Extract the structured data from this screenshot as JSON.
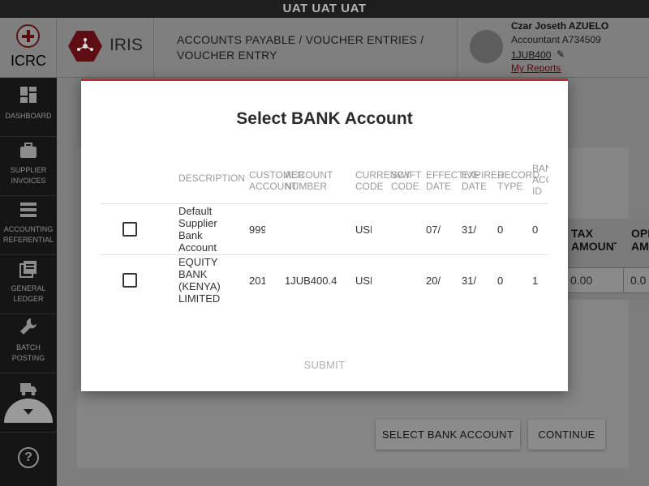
{
  "env_banner": "UAT UAT UAT",
  "header": {
    "org_name": "ICRC",
    "app_name": "IRIS",
    "breadcrumb": "ACCOUNTS PAYABLE / VOUCHER ENTRIES /\nVOUCHER ENTRY",
    "user": {
      "name": "Czar Joseth AZUELO",
      "role": "Accountant A734509",
      "code": "1JUB400",
      "reports_link": "My Reports"
    }
  },
  "sidebar": {
    "items": [
      {
        "label": "DASHBOARD",
        "icon": "dashboard-icon"
      },
      {
        "label": "SUPPLIER\nINVOICES",
        "icon": "briefcase-icon"
      },
      {
        "label": "ACCOUNTING\nREFERENTIAL",
        "icon": "list-icon"
      },
      {
        "label": "GENERAL\nLEDGER",
        "icon": "ledger-icon"
      },
      {
        "label": "BATCH\nPOSTING",
        "icon": "wrench-icon"
      },
      {
        "label": "",
        "icon": "truck-icon"
      }
    ],
    "help_icon": "?"
  },
  "background": {
    "columns": [
      "TAX\nAMOUNT",
      "OPE\nAMO"
    ],
    "inputs": [
      "0.00",
      "0.0"
    ],
    "buttons": {
      "select_bank": "SELECT BANK ACCOUNT",
      "continue": "CONTINUE"
    }
  },
  "modal": {
    "title": "Select BANK Account",
    "columns": [
      "DESCRIPTION",
      "CUSTOMER\nACCOUNT",
      "ACCOUNT\nNUMBER",
      "CURRENCY\nCODE",
      "SWIFT\nCODE",
      "EFFECTIVE\nDATE",
      "EXPIRED\nDATE",
      "RECORD\nTYPE",
      "BANK\nACCOUNT\nID"
    ],
    "rows": [
      {
        "description": "Default\nSupplier\n Bank\nAccount",
        "customer_account": "999",
        "account_number": "",
        "currency_code": "USD",
        "swift_code": "",
        "effective_date": "07/",
        "expired_date": "31/",
        "record_type": "0",
        "bank_account_id": "0"
      },
      {
        "description": "EQUITY\nBANK\n(KENYA)\nLIMITED",
        "customer_account": "201",
        "account_number": "1JUB400.4",
        "currency_code": "USD",
        "swift_code": "",
        "effective_date": "20/",
        "expired_date": "31/",
        "record_type": "0",
        "bank_account_id": "1"
      }
    ],
    "submit_label": "SUBMIT"
  },
  "colors": {
    "accent": "#c0283b",
    "brand": "#5e0e13",
    "sidebar_bg": "#151515"
  }
}
